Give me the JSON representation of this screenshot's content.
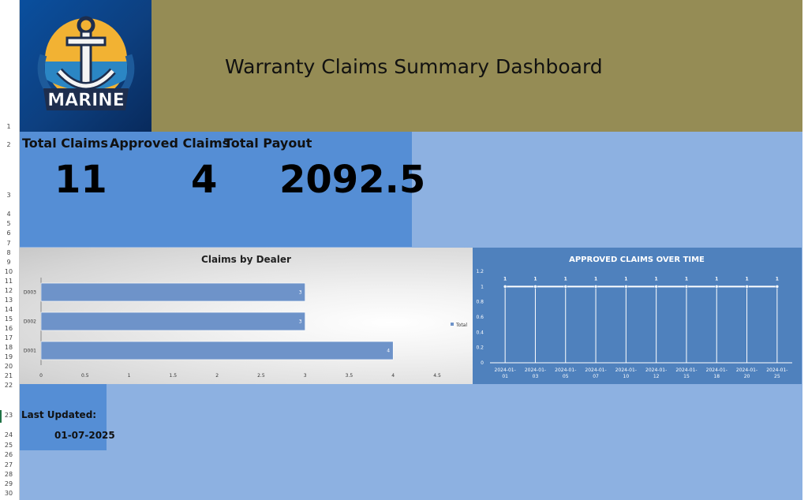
{
  "header": {
    "title": "Warranty Claims Summary Dashboard",
    "logo_text": "MARINE"
  },
  "kpis": [
    {
      "label": "Total Claims",
      "value": "11"
    },
    {
      "label": "Approved Claims",
      "value": "4"
    },
    {
      "label": "Total Payout",
      "value": "2092.5"
    }
  ],
  "last_updated": {
    "label": "Last Updated:",
    "date": "01-07-2025"
  },
  "row_numbers": [
    "1",
    "2",
    "3",
    "4",
    "5",
    "6",
    "7",
    "8",
    "9",
    "10",
    "11",
    "12",
    "13",
    "14",
    "15",
    "16",
    "17",
    "18",
    "19",
    "20",
    "21",
    "22",
    "23",
    "24",
    "25",
    "26",
    "27",
    "28",
    "29",
    "30"
  ],
  "colors": {
    "banner": "#958c55",
    "kpi_panel": "#558ed5",
    "sheet_background": "#8db1e1",
    "bar_fill": "#6e93c9",
    "line_chart_background": "#4f81bd"
  },
  "chart_data": [
    {
      "type": "bar",
      "orientation": "horizontal",
      "title": "Claims by Dealer",
      "categories": [
        "D001",
        "D002",
        "D003"
      ],
      "series": [
        {
          "name": "Total",
          "values": [
            4,
            3,
            3
          ]
        }
      ],
      "xlim": [
        0,
        4.5
      ],
      "xticks": [
        "0",
        "0.5",
        "1",
        "1.5",
        "2",
        "2.5",
        "3",
        "3.5",
        "4",
        "4.5"
      ],
      "legend": "right"
    },
    {
      "type": "line",
      "title": "APPROVED CLAIMS OVER TIME",
      "x": [
        "2024-01-01",
        "2024-01-03",
        "2024-01-05",
        "2024-01-07",
        "2024-01-10",
        "2024-01-12",
        "2024-01-15",
        "2024-01-18",
        "2024-01-20",
        "2024-01-25"
      ],
      "x_tick_labels": [
        [
          "2024-01-",
          "01"
        ],
        [
          "2024-01-",
          "03"
        ],
        [
          "2024-01-",
          "05"
        ],
        [
          "2024-01-",
          "07"
        ],
        [
          "2024-01-",
          "10"
        ],
        [
          "2024-01-",
          "12"
        ],
        [
          "2024-01-",
          "15"
        ],
        [
          "2024-01-",
          "18"
        ],
        [
          "2024-01-",
          "20"
        ],
        [
          "2024-01-",
          "25"
        ]
      ],
      "values": [
        1,
        1,
        1,
        1,
        1,
        1,
        1,
        1,
        1,
        1
      ],
      "ylim": [
        0,
        1.2
      ],
      "yticks": [
        "0",
        "0.2",
        "0.4",
        "0.6",
        "0.8",
        "1",
        "1.2"
      ],
      "grid": "vertical drop lines"
    }
  ]
}
